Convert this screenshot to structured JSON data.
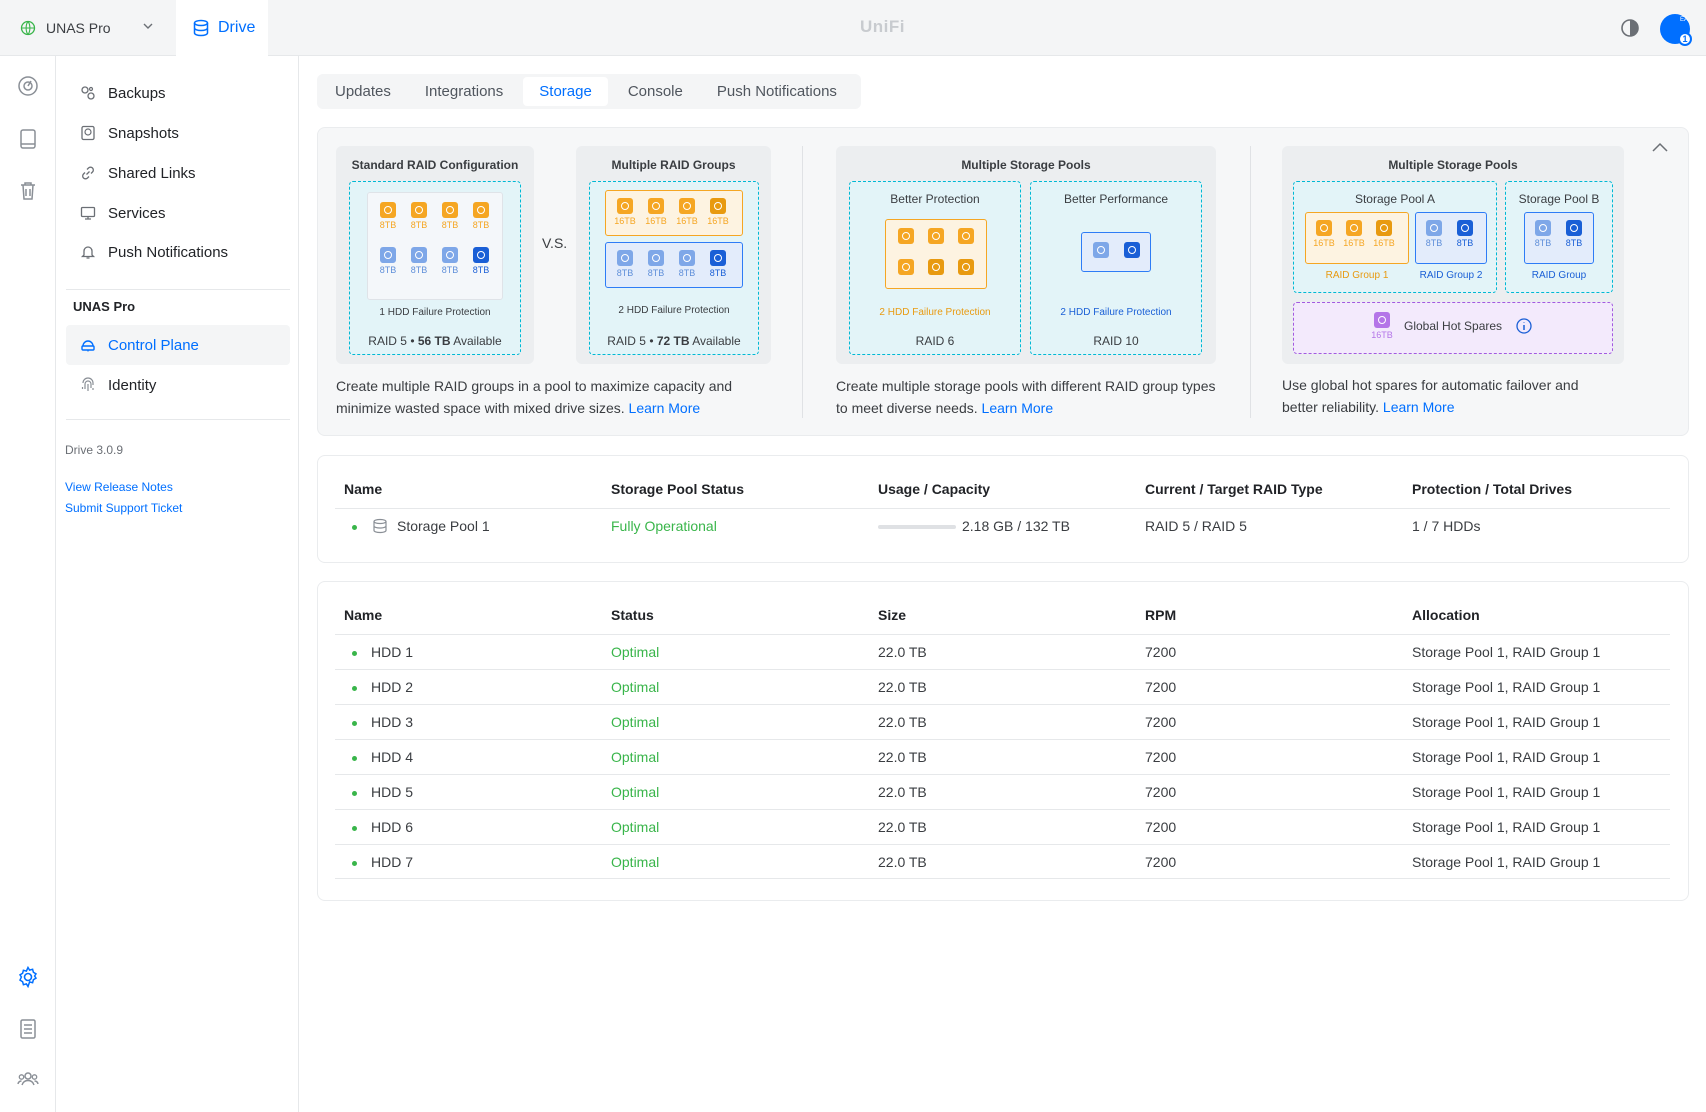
{
  "topbar": {
    "device": "UNAS Pro",
    "app": "Drive",
    "logo": "UniFi",
    "avatar_initials": "EA",
    "notification_count": "1"
  },
  "rail": {
    "icons": [
      "speedometer-icon",
      "drive-icon",
      "trash-icon",
      "settings-icon",
      "logs-icon",
      "users-icon"
    ]
  },
  "sidebar": {
    "items": [
      {
        "label": "Backups",
        "icon": "backups-icon"
      },
      {
        "label": "Snapshots",
        "icon": "snapshots-icon"
      },
      {
        "label": "Shared Links",
        "icon": "link-icon"
      },
      {
        "label": "Services",
        "icon": "monitor-icon"
      },
      {
        "label": "Push Notifications",
        "icon": "bell-icon"
      }
    ],
    "section_heading": "UNAS Pro",
    "section_items": [
      {
        "label": "Control Plane",
        "icon": "control-plane-icon",
        "active": true
      },
      {
        "label": "Identity",
        "icon": "fingerprint-icon"
      }
    ],
    "version": "Drive 3.0.9",
    "links": [
      "View Release Notes",
      "Submit Support Ticket"
    ]
  },
  "tabs": [
    "Updates",
    "Integrations",
    "Storage",
    "Console",
    "Push Notifications"
  ],
  "active_tab": "Storage",
  "info": {
    "standard": {
      "title": "Standard RAID Configuration",
      "top_labels": [
        "8TB",
        "8TB",
        "8TB",
        "8TB"
      ],
      "bottom_labels": [
        "8TB",
        "8TB",
        "8TB",
        "8TB"
      ],
      "protection": "1 HDD Failure Protection",
      "raid": "RAID 5",
      "capacity": "56 TB",
      "available": "Available"
    },
    "vs": "V.S.",
    "multiple": {
      "title": "Multiple RAID Groups",
      "top_labels": [
        "16TB",
        "16TB",
        "16TB",
        "16TB"
      ],
      "bottom_labels": [
        "8TB",
        "8TB",
        "8TB",
        "8TB"
      ],
      "protection": "2 HDD Failure Protection",
      "raid": "RAID 5",
      "capacity": "72 TB",
      "available": "Available"
    },
    "desc1": "Create multiple RAID groups in a pool to maximize capacity and minimize wasted space with mixed drive sizes.",
    "pools": {
      "title": "Multiple Storage Pools",
      "left_title": "Better Protection",
      "left_protection": "2 HDD Failure Protection",
      "left_raid": "RAID 6",
      "right_title": "Better Performance",
      "right_protection": "2 HDD Failure Protection",
      "right_raid": "RAID 10"
    },
    "desc2": "Create multiple storage pools with different RAID group types to meet diverse needs.",
    "spares": {
      "title": "Multiple Storage Pools",
      "pool_a": "Storage Pool A",
      "pool_b": "Storage Pool B",
      "group1_labels": [
        "16TB",
        "16TB",
        "16TB"
      ],
      "group2_labels": [
        "8TB",
        "8TB"
      ],
      "groupb_labels": [
        "8TB",
        "8TB"
      ],
      "group1": "RAID Group 1",
      "group2": "RAID Group 2",
      "groupb": "RAID Group",
      "hot_spares": "Global Hot Spares",
      "spare_label": "16TB"
    },
    "desc3": "Use global hot spares for automatic failover and better reliability.",
    "learn_more": "Learn More"
  },
  "pool_table": {
    "headers": [
      "Name",
      "Storage Pool Status",
      "Usage / Capacity",
      "Current / Target RAID Type",
      "Protection / Total Drives"
    ],
    "rows": [
      {
        "name": "Storage Pool 1",
        "status": "Fully Operational",
        "usage": "2.18 GB / 132 TB",
        "raid": "RAID 5 / RAID 5",
        "protection": "1 / 7 HDDs"
      }
    ]
  },
  "drive_table": {
    "headers": [
      "Name",
      "Status",
      "Size",
      "RPM",
      "Allocation"
    ],
    "rows": [
      {
        "name": "HDD 1",
        "status": "Optimal",
        "size": "22.0 TB",
        "rpm": "7200",
        "allocation": "Storage Pool 1, RAID Group 1"
      },
      {
        "name": "HDD 2",
        "status": "Optimal",
        "size": "22.0 TB",
        "rpm": "7200",
        "allocation": "Storage Pool 1, RAID Group 1"
      },
      {
        "name": "HDD 3",
        "status": "Optimal",
        "size": "22.0 TB",
        "rpm": "7200",
        "allocation": "Storage Pool 1, RAID Group 1"
      },
      {
        "name": "HDD 4",
        "status": "Optimal",
        "size": "22.0 TB",
        "rpm": "7200",
        "allocation": "Storage Pool 1, RAID Group 1"
      },
      {
        "name": "HDD 5",
        "status": "Optimal",
        "size": "22.0 TB",
        "rpm": "7200",
        "allocation": "Storage Pool 1, RAID Group 1"
      },
      {
        "name": "HDD 6",
        "status": "Optimal",
        "size": "22.0 TB",
        "rpm": "7200",
        "allocation": "Storage Pool 1, RAID Group 1"
      },
      {
        "name": "HDD 7",
        "status": "Optimal",
        "size": "22.0 TB",
        "rpm": "7200",
        "allocation": "Storage Pool 1, RAID Group 1"
      }
    ]
  },
  "colors": {
    "accent": "#006fff",
    "ok": "#39b54a",
    "orange": "#f5a623",
    "cyan": "#00b8d4",
    "purple": "#a25be0"
  }
}
